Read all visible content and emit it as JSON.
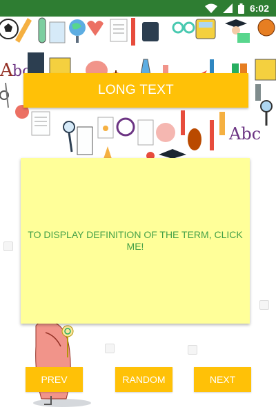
{
  "status_bar": {
    "time": "6:02",
    "icons": [
      "wifi-icon",
      "cellular-signal-icon",
      "battery-icon"
    ]
  },
  "app": {
    "title": "LONG TEXT",
    "card_text": "TO DISPLAY DEFINITION OF THE TERM, CLICK ME!"
  },
  "buttons": {
    "prev": "PREV",
    "random": "RANDOM",
    "next": "NEXT"
  },
  "background_icons": [
    "soccer-ball-icon",
    "ruler-icon",
    "test-tube-icon",
    "books-icon",
    "globe-icon",
    "heart-icon",
    "clipboard-icon",
    "pencil-icon",
    "backpack-icon",
    "glasses-icon",
    "school-bus-icon",
    "graduation-cap-icon",
    "puzzle-icon",
    "basketball-icon",
    "abc-letters-icon",
    "calculator-icon",
    "brain-icon",
    "apple-icon",
    "flask-icon",
    "microscope-icon",
    "paper-plane-icon",
    "alarm-clock-icon",
    "magnifier-icon",
    "rugby-ball-icon",
    "document-icon",
    "scissors-icon"
  ],
  "colors": {
    "status_bar": "#2e7d32",
    "accent": "#ffc107",
    "card_background": "#ffff99",
    "card_text": "#43a047",
    "button_text": "#ffffff"
  }
}
